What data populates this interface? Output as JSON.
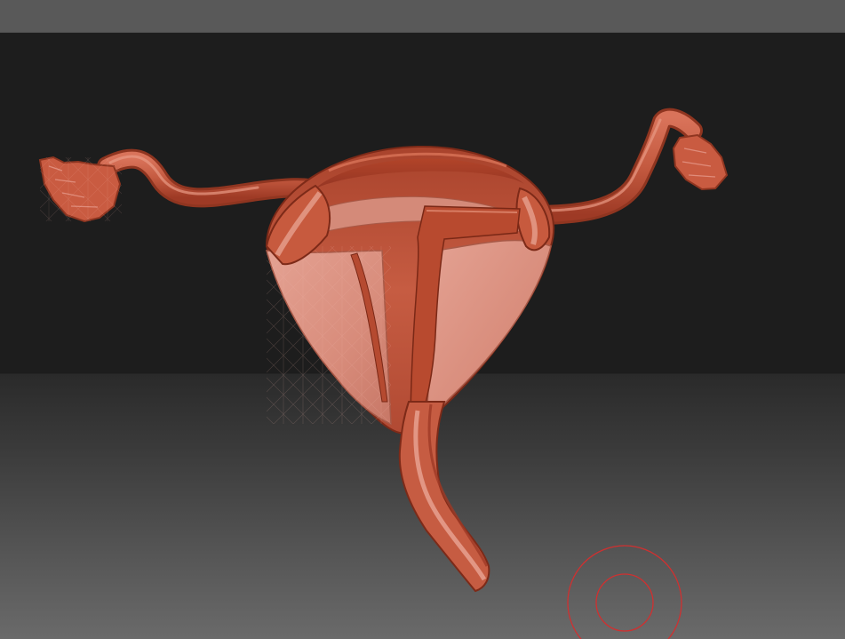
{
  "app": {
    "kind": "3d-sculpting-viewport"
  },
  "model": {
    "subject": "uterus-anatomy-cutaway",
    "material_color": "#c9624a",
    "interior_color": "#dd9585",
    "wire_color": "#b8766a"
  },
  "viewport": {
    "background_top": "#1d1d1d",
    "background_bottom": "#6a6a6a"
  },
  "cursor": {
    "type": "brush-ring",
    "color": "#d03030"
  }
}
